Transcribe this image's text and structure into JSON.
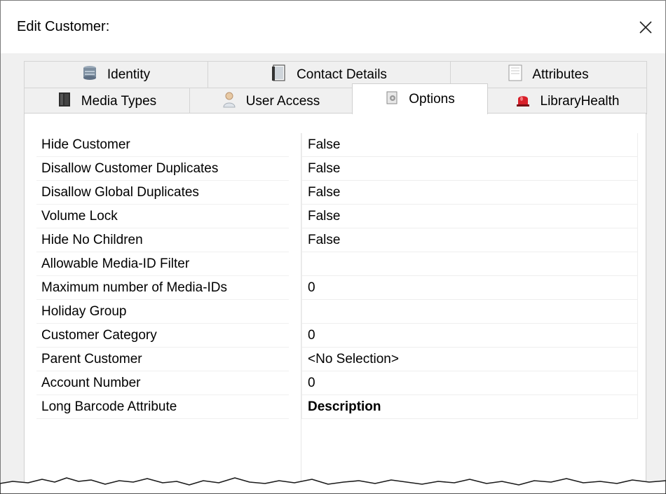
{
  "window": {
    "title": "Edit Customer:",
    "close_icon": "close-icon"
  },
  "tabs": {
    "row_back": [
      {
        "label": "Identity",
        "icon": "server-icon"
      },
      {
        "label": "Contact Details",
        "icon": "contact-card-icon"
      },
      {
        "label": "Attributes",
        "icon": "attributes-page-icon"
      }
    ],
    "row_front": [
      {
        "label": "Media Types",
        "icon": "media-book-icon"
      },
      {
        "label": "User Access",
        "icon": "user-icon"
      },
      {
        "label": "Options",
        "icon": "options-icon",
        "active": true
      },
      {
        "label": "LibraryHealth",
        "icon": "alarm-light-icon"
      }
    ]
  },
  "properties": [
    {
      "name": "Hide Customer",
      "value": "False"
    },
    {
      "name": "Disallow Customer Duplicates",
      "value": "False"
    },
    {
      "name": "Disallow Global Duplicates",
      "value": "False"
    },
    {
      "name": "Volume Lock",
      "value": "False"
    },
    {
      "name": "Hide No Children",
      "value": "False"
    },
    {
      "name": "Allowable Media-ID Filter",
      "value": ""
    },
    {
      "name": "Maximum number of Media-IDs",
      "value": "0"
    },
    {
      "name": "Holiday Group",
      "value": ""
    },
    {
      "name": "Customer Category",
      "value": "0"
    },
    {
      "name": "Parent Customer",
      "value": "<No Selection>"
    },
    {
      "name": "Account Number",
      "value": "0"
    },
    {
      "name": "Long Barcode Attribute",
      "value": "Description"
    }
  ],
  "colors": {
    "alarm_red": "#d8202a",
    "border": "#d0d0d0",
    "dialog_bg": "#f0f0f0"
  }
}
